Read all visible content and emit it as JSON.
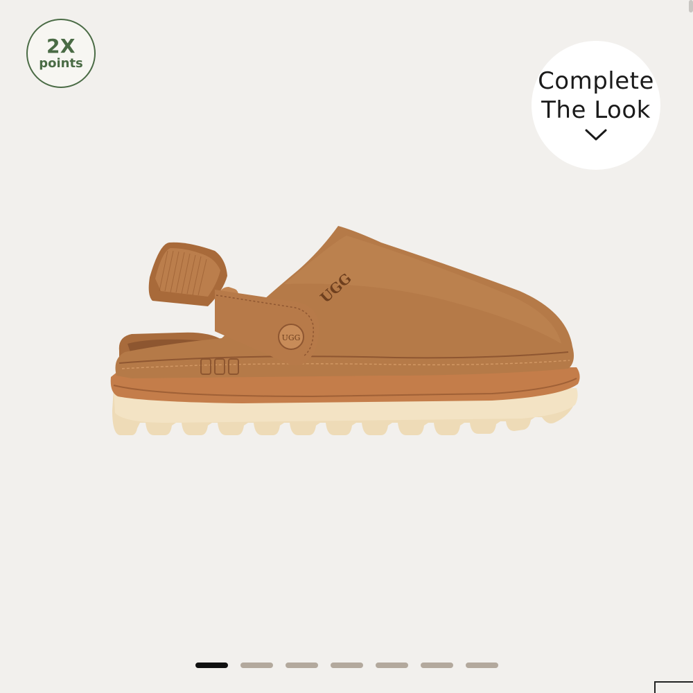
{
  "points_badge": {
    "multiplier": "2X",
    "label": "points"
  },
  "complete_the_look": {
    "line1": "Complete",
    "line2": "The Look",
    "icon": "chevron-down-icon"
  },
  "product_image": {
    "alt": "UGG clog with back strap in chestnut suede",
    "logo_text": "UGG",
    "colors": {
      "suede": "#b27645",
      "suede_dark": "#8f5a31",
      "sole": "#efdcb8",
      "midsole": "#c07a48"
    }
  },
  "carousel": {
    "count": 7,
    "active_index": 0
  },
  "colors": {
    "background": "#f2f0ed",
    "badge_green": "#4a6b45",
    "dot_inactive": "#b3a99d",
    "dot_active": "#111111"
  }
}
